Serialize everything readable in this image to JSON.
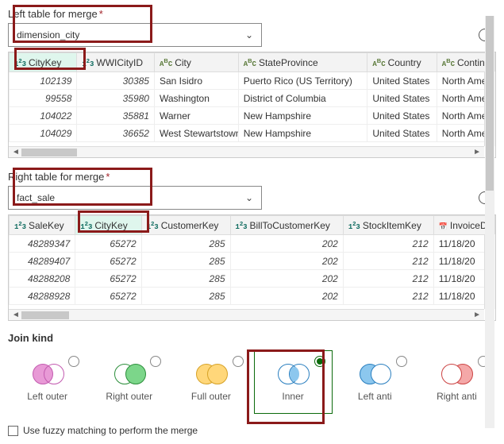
{
  "left": {
    "label": "Left table for merge",
    "required": "*",
    "selected": "dimension_city",
    "columns": [
      {
        "type": "123",
        "name": "CityKey",
        "selected": true,
        "kind": "num"
      },
      {
        "type": "123",
        "name": "WWICityID",
        "kind": "num"
      },
      {
        "type": "ABC",
        "name": "City",
        "kind": "txt"
      },
      {
        "type": "ABC",
        "name": "StateProvince",
        "kind": "txt"
      },
      {
        "type": "ABC",
        "name": "Country",
        "kind": "txt"
      },
      {
        "type": "ABC",
        "name": "Continent",
        "kind": "txt"
      }
    ],
    "rows": [
      {
        "CityKey": "102139",
        "WWICityID": "30385",
        "City": "San Isidro",
        "StateProvince": "Puerto Rico (US Territory)",
        "Country": "United States",
        "Continent": "North Amer"
      },
      {
        "CityKey": "99558",
        "WWICityID": "35980",
        "City": "Washington",
        "StateProvince": "District of Columbia",
        "Country": "United States",
        "Continent": "North Amer"
      },
      {
        "CityKey": "104022",
        "WWICityID": "35881",
        "City": "Warner",
        "StateProvince": "New Hampshire",
        "Country": "United States",
        "Continent": "North Amer"
      },
      {
        "CityKey": "104029",
        "WWICityID": "36652",
        "City": "West Stewartstown",
        "StateProvince": "New Hampshire",
        "Country": "United States",
        "Continent": "North Amer"
      }
    ]
  },
  "right": {
    "label": "Right table for merge",
    "required": "*",
    "selected": "fact_sale",
    "columns": [
      {
        "type": "123",
        "name": "SaleKey",
        "kind": "num"
      },
      {
        "type": "123",
        "name": "CityKey",
        "selected": true,
        "kind": "num"
      },
      {
        "type": "123",
        "name": "CustomerKey",
        "kind": "num"
      },
      {
        "type": "123",
        "name": "BillToCustomerKey",
        "kind": "num"
      },
      {
        "type": "123",
        "name": "StockItemKey",
        "kind": "num"
      },
      {
        "type": "date",
        "name": "InvoiceDa",
        "kind": "date"
      }
    ],
    "rows": [
      {
        "SaleKey": "48289347",
        "CityKey": "65272",
        "CustomerKey": "285",
        "BillToCustomerKey": "202",
        "StockItemKey": "212",
        "InvoiceDa": "11/18/20"
      },
      {
        "SaleKey": "48289407",
        "CityKey": "65272",
        "CustomerKey": "285",
        "BillToCustomerKey": "202",
        "StockItemKey": "212",
        "InvoiceDa": "11/18/20"
      },
      {
        "SaleKey": "48288208",
        "CityKey": "65272",
        "CustomerKey": "285",
        "BillToCustomerKey": "202",
        "StockItemKey": "212",
        "InvoiceDa": "11/18/20"
      },
      {
        "SaleKey": "48288928",
        "CityKey": "65272",
        "CustomerKey": "285",
        "BillToCustomerKey": "202",
        "StockItemKey": "212",
        "InvoiceDa": "11/18/20"
      }
    ]
  },
  "join": {
    "title": "Join kind",
    "kinds": [
      {
        "id": "left-outer",
        "label": "Left outer",
        "cls": "lo"
      },
      {
        "id": "right-outer",
        "label": "Right outer",
        "cls": "ro"
      },
      {
        "id": "full-outer",
        "label": "Full outer",
        "cls": "fo"
      },
      {
        "id": "inner",
        "label": "Inner",
        "cls": "in",
        "selected": true
      },
      {
        "id": "left-anti",
        "label": "Left anti",
        "cls": "la"
      },
      {
        "id": "right-anti",
        "label": "Right anti",
        "cls": "ra"
      }
    ]
  },
  "fuzzy": {
    "label": "Use fuzzy matching to perform the merge",
    "checked": false
  }
}
